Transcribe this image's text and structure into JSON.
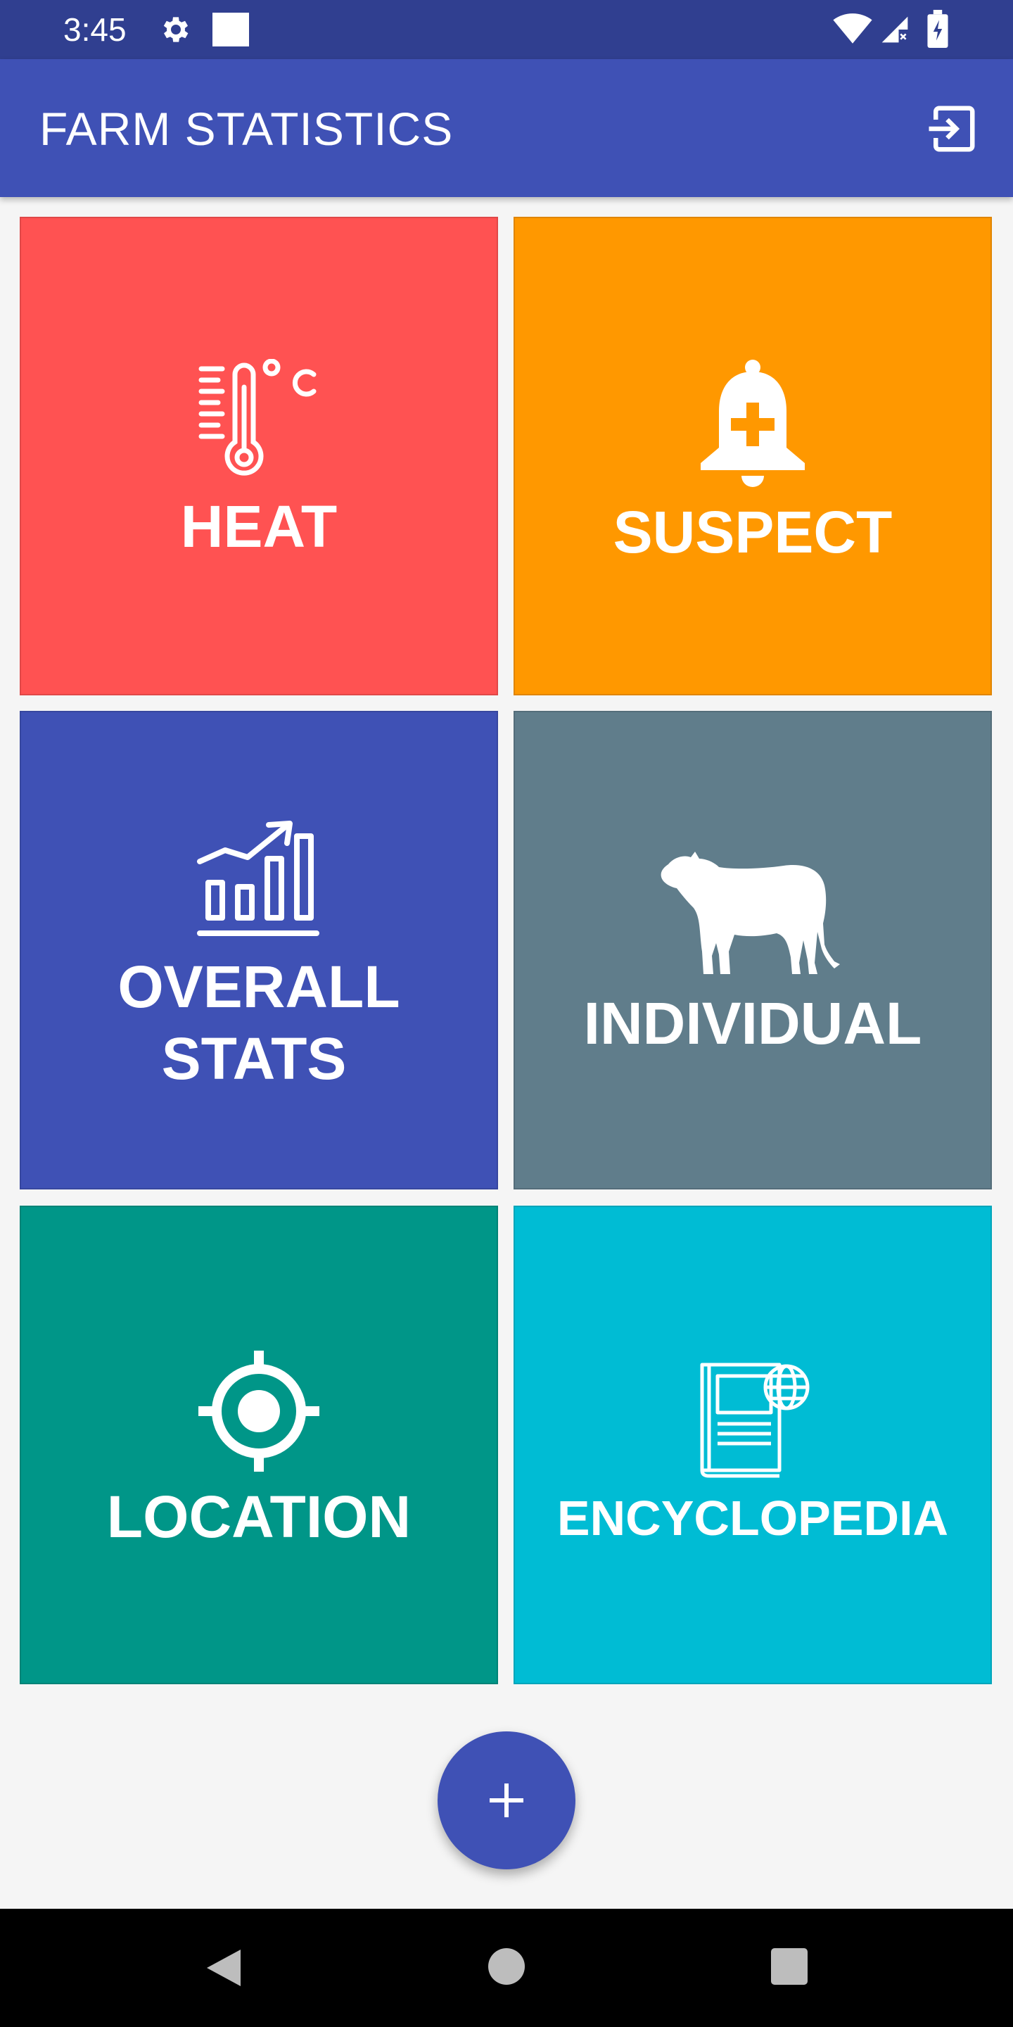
{
  "status_bar": {
    "time": "3:45",
    "icons": [
      "gear-icon",
      "square-notification-icon",
      "wifi-icon",
      "signal-icon",
      "battery-icon"
    ]
  },
  "app_bar": {
    "title": "FARM STATISTICS",
    "action_icon": "logout-icon"
  },
  "tiles": [
    {
      "label": "HEAT",
      "icon": "thermometer-icon",
      "color": "#ff5252"
    },
    {
      "label": "SUSPECT",
      "icon": "bell-plus-icon",
      "color": "#ff9800"
    },
    {
      "label_line1": "OVERALL",
      "label_line2": "STATS",
      "icon": "bar-chart-icon",
      "color": "#3f51b5"
    },
    {
      "label": "INDIVIDUAL",
      "icon": "cow-icon",
      "color": "#607d8b"
    },
    {
      "label": "LOCATION",
      "icon": "location-target-icon",
      "color": "#009688"
    },
    {
      "label": "ENCYCLOPEDIA",
      "icon": "book-globe-icon",
      "color": "#00bcd4"
    }
  ],
  "fab": {
    "icon": "plus-icon"
  },
  "colors": {
    "status_bar": "#303f90",
    "primary": "#3f51b5",
    "background": "#f5f5f5"
  }
}
